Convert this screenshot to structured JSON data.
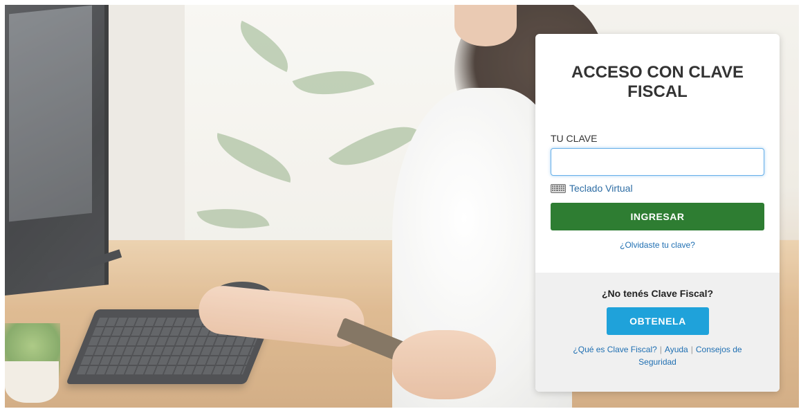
{
  "login": {
    "title": "ACCESO CON CLAVE FISCAL",
    "field_label": "TU CLAVE",
    "clave_value": "",
    "virtual_keyboard_label": "Teclado Virtual",
    "submit_label": "INGRESAR",
    "forgot_label": "¿Olvidaste tu clave?"
  },
  "signup": {
    "prompt": "¿No tenés Clave Fiscal?",
    "button_label": "OBTENELA",
    "links": {
      "what_is": "¿Qué es Clave Fiscal?",
      "help": "Ayuda",
      "security": "Consejos de Seguridad",
      "separator": "|"
    }
  },
  "icons": {
    "virtual_keyboard": "keyboard-icon"
  },
  "colors": {
    "submit": "#2e7d32",
    "obtain": "#1fa2da",
    "link": "#1f6fb2",
    "input_focus": "#66afe9"
  }
}
